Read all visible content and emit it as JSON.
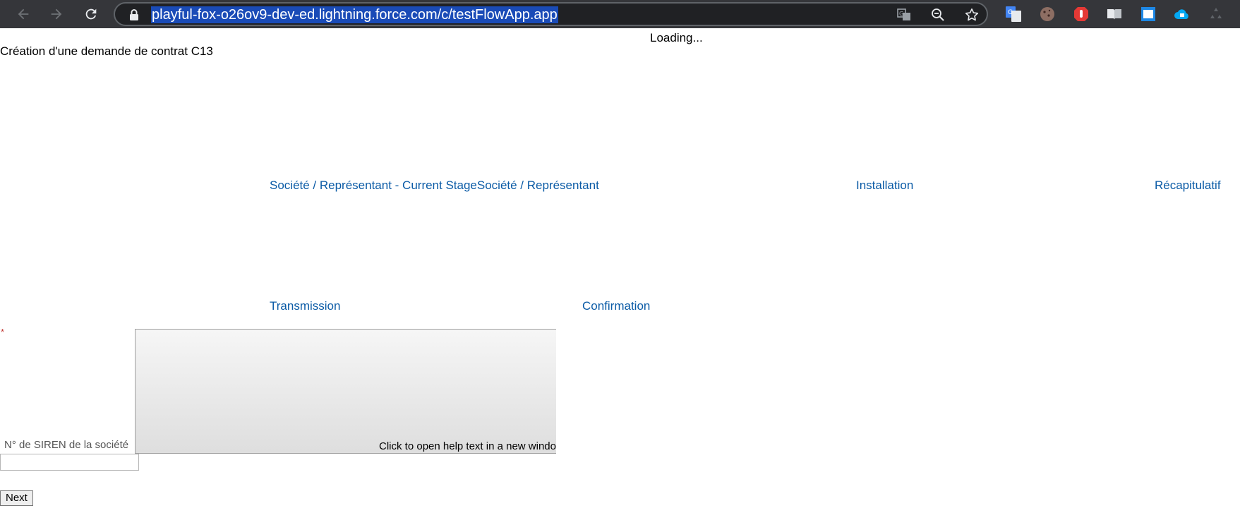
{
  "browser": {
    "url": "playful-fox-o26ov9-dev-ed.lightning.force.com/c/testFlowApp.app",
    "icons": {
      "back": "arrow-left-icon",
      "forward": "arrow-right-icon",
      "reload": "reload-icon",
      "lock": "lock-icon",
      "translate": "translate-icon",
      "zoom": "zoom-out-icon",
      "bookmark": "star-icon"
    },
    "extensions": [
      "google-translate-icon",
      "cookie-icon",
      "adblock-hand-icon",
      "reader-book-icon",
      "window-frame-icon",
      "cloud-lock-icon",
      "recycle-icon"
    ],
    "colors": {
      "toolbar": "#35363a",
      "url_highlight": "#1a4bb7"
    }
  },
  "page": {
    "loading": "Loading...",
    "title": "Création d'une demande de contrat C13",
    "stages": [
      {
        "label": "Société / Représentant - Current StageSociété / Représentant",
        "current": true
      },
      {
        "label": "Installation",
        "current": false
      },
      {
        "label": "Récapitulatif",
        "current": false
      },
      {
        "label": "Transmission",
        "current": false
      },
      {
        "label": "Confirmation",
        "current": false
      }
    ],
    "form": {
      "required_mark": "*",
      "field_label": "N° de SIREN de la société",
      "help_text": "Click to open help text in a new windo",
      "field_value": "",
      "next_label": "Next"
    },
    "colors": {
      "link": "#0b5ba6",
      "required": "#c23934"
    }
  }
}
